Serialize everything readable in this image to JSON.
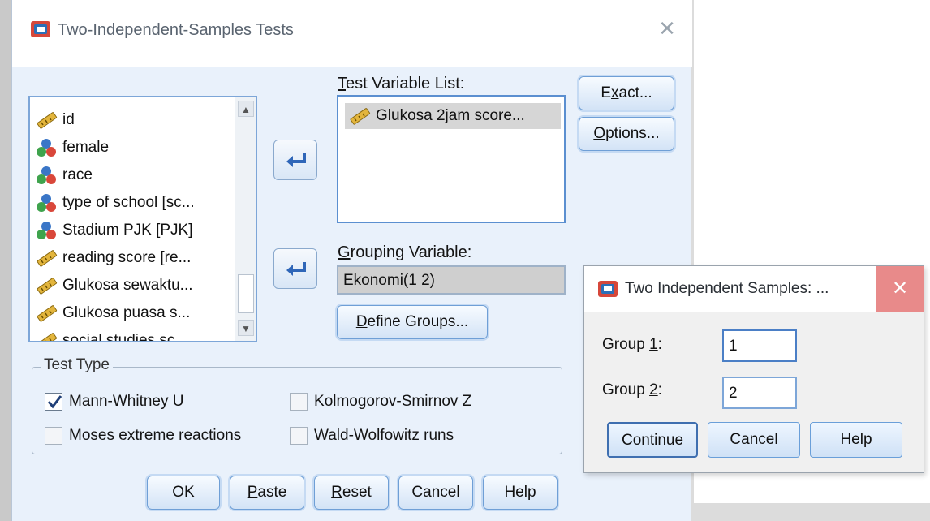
{
  "main_dialog": {
    "title": "Two-Independent-Samples Tests",
    "source_variables": [
      {
        "label": "id",
        "icon": "scale-ruler-icon"
      },
      {
        "label": "female",
        "icon": "nominal-circles-icon"
      },
      {
        "label": "race",
        "icon": "nominal-circles-icon"
      },
      {
        "label": "type of school [sc...",
        "icon": "nominal-circles-icon"
      },
      {
        "label": "Stadium PJK [PJK]",
        "icon": "nominal-circles-icon"
      },
      {
        "label": "reading score [re...",
        "icon": "scale-ruler-icon"
      },
      {
        "label": "Glukosa sewaktu...",
        "icon": "scale-ruler-icon"
      },
      {
        "label": "Glukosa puasa s...",
        "icon": "scale-ruler-icon"
      },
      {
        "label": "social studies sc...",
        "icon": "scale-ruler-icon"
      }
    ],
    "test_variable_list": {
      "label_pre": "",
      "label_ul": "T",
      "label_post": "est Variable List:",
      "items": [
        "Glukosa 2jam score..."
      ]
    },
    "grouping_variable": {
      "label_pre": "",
      "label_ul": "G",
      "label_post": "rouping Variable:",
      "value": "Ekonomi(1 2)"
    },
    "buttons": {
      "exact": {
        "pre": "E",
        "ul": "x",
        "post": "act..."
      },
      "options": {
        "pre": "",
        "ul": "O",
        "post": "ptions..."
      },
      "define_groups": {
        "pre": "",
        "ul": "D",
        "post": "efine Groups..."
      },
      "ok": "OK",
      "paste": {
        "pre": "",
        "ul": "P",
        "post": "aste"
      },
      "reset": {
        "pre": "",
        "ul": "R",
        "post": "eset"
      },
      "cancel": "Cancel",
      "help": "Help"
    },
    "test_type": {
      "legend": "Test Type",
      "options": [
        {
          "pre": "",
          "ul": "M",
          "post": "ann-Whitney U",
          "checked": true
        },
        {
          "pre": "",
          "ul": "K",
          "post": "olmogorov-Smirnov Z",
          "checked": false
        },
        {
          "pre": "Mo",
          "ul": "s",
          "post": "es extreme reactions",
          "checked": false
        },
        {
          "pre": "",
          "ul": "W",
          "post": "ald-Wolfowitz runs",
          "checked": false
        }
      ]
    }
  },
  "define_groups_dialog": {
    "title": "Two Independent Samples: ...",
    "group1": {
      "pre": "Group ",
      "ul": "1",
      "post": ":",
      "value": "1"
    },
    "group2": {
      "pre": "Group ",
      "ul": "2",
      "post": ":",
      "value": "2"
    },
    "buttons": {
      "continue": {
        "pre": "",
        "ul": "C",
        "post": "ontinue"
      },
      "cancel": "Cancel",
      "help": "Help"
    }
  },
  "colors": {
    "dialog_bg": "#e9f1fb",
    "button_border": "#6f9fd6",
    "close_hover_red": "#e88a8a"
  }
}
